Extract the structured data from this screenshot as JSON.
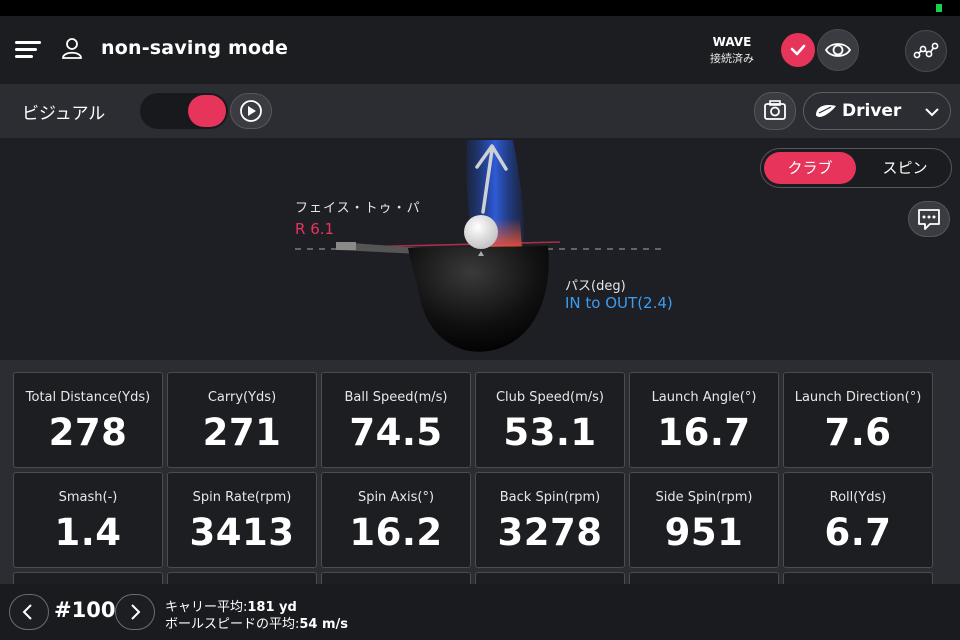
{
  "header": {
    "mode_title": "non-saving mode",
    "wave_title": "WAVE",
    "wave_status": "接続済み"
  },
  "toolbar": {
    "visual_label": "ビジュアル",
    "visual_toggle_on": true,
    "club_selected": "Driver"
  },
  "visual": {
    "segment_options": [
      "クラブ",
      "スピン"
    ],
    "segment_active": "クラブ",
    "face_to_path_label": "フェイス・トゥ・パ",
    "face_to_path_value": "R 6.1",
    "path_label": "パス(deg)",
    "path_value": "IN to OUT(2.4)"
  },
  "metrics": [
    {
      "label": "Total Distance(Yds)",
      "value": "278"
    },
    {
      "label": "Carry(Yds)",
      "value": "271"
    },
    {
      "label": "Ball Speed(m/s)",
      "value": "74.5"
    },
    {
      "label": "Club Speed(m/s)",
      "value": "53.1"
    },
    {
      "label": "Launch Angle(°)",
      "value": "16.7"
    },
    {
      "label": "Launch Direction(°)",
      "value": "7.6"
    },
    {
      "label": "Smash(-)",
      "value": "1.4"
    },
    {
      "label": "Spin Rate(rpm)",
      "value": "3413"
    },
    {
      "label": "Spin Axis(°)",
      "value": "16.2"
    },
    {
      "label": "Back Spin(rpm)",
      "value": "3278"
    },
    {
      "label": "Side Spin(rpm)",
      "value": "951"
    },
    {
      "label": "Roll(Yds)",
      "value": "6.7"
    }
  ],
  "footer": {
    "shot_number": "#100",
    "carry_avg_label": "キャリー平均:",
    "carry_avg_value": "181 yd",
    "ball_speed_avg_label": "ボールスピードの平均:",
    "ball_speed_avg_value": "54 m/s"
  },
  "colors": {
    "accent": "#e6345a",
    "path_blue": "#3c9cf0",
    "background": "#1d1f25",
    "panel": "#2b2d32"
  },
  "icons": {
    "menu": "hamburger-icon",
    "user": "user-icon",
    "check": "check-icon",
    "eye": "eye-icon",
    "share": "share-nodes-icon",
    "play": "play-icon",
    "camera": "camera-icon",
    "club": "driver-club-icon",
    "chevron": "chevron-down-icon",
    "chat": "chat-bubble-icon",
    "prev": "chevron-left-icon",
    "next": "chevron-right-icon"
  }
}
